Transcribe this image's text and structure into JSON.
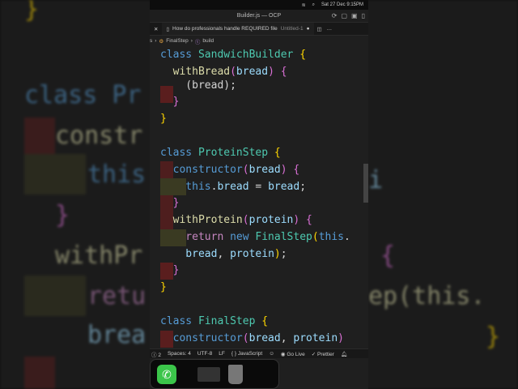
{
  "menubar": {
    "datetime": "Sat 27 Dec  9:15PM"
  },
  "window": {
    "title": "Builder.js — OCP"
  },
  "tab": {
    "label": "How do professionals handle REQUIRED file",
    "secondary": "Untitled-1"
  },
  "breadcrumb": {
    "prefix": "s",
    "item1": "FinalStep",
    "item2": "build"
  },
  "code": [
    "class SandwichBuilder {",
    "  withBread(bread) {",
    "    (bread);",
    "  }",
    "}",
    "",
    "class ProteinStep {",
    "  constructor(bread) {",
    "    this.bread = bread;",
    "  }",
    "  withProtein(protein) {",
    "    return new FinalStep(this.",
    "    bread, protein);",
    "  }",
    "}",
    "",
    "class FinalStep {",
    "  constructor(bread, protein)"
  ],
  "status": {
    "problems": "2",
    "spaces": "Spaces: 4",
    "encoding": "UTF-8",
    "eol": "LF",
    "language": "JavaScript",
    "golive": "Go Live",
    "prettier": "Prettier"
  },
  "background": {
    "left1": "}",
    "left2": "class Pr",
    "left3": "constr",
    "left4": "this",
    "left5": "}",
    "left6": "withPr",
    "left7": "retu",
    "left8": "brea",
    "right1": "i",
    "right2": "{",
    "right3": "ep(this.",
    "right4": "}"
  }
}
